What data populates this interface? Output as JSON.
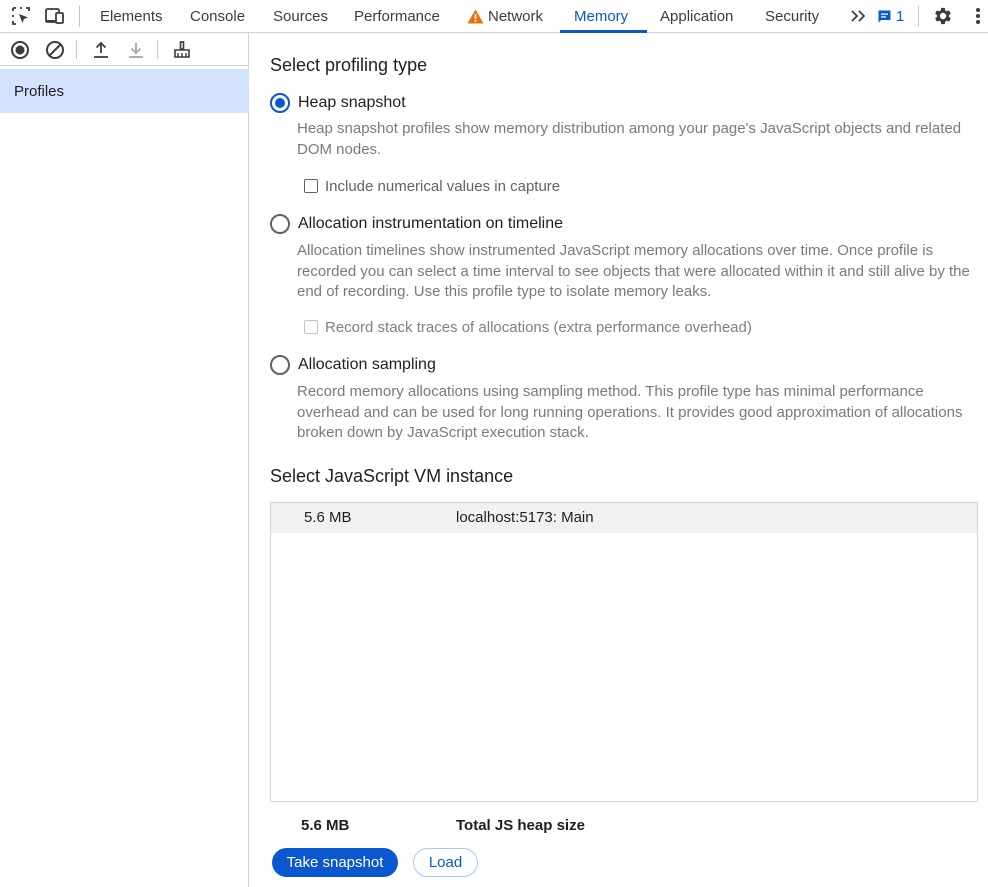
{
  "toolbar": {
    "icons": {
      "inspect": "inspect-element-icon",
      "device": "device-toolbar-icon",
      "more_tabs": "chevron-double-right-icon",
      "issues": "message-icon",
      "settings": "gear-icon",
      "menu": "kebab-menu-icon"
    },
    "tabs": [
      {
        "label": "Elements"
      },
      {
        "label": "Console"
      },
      {
        "label": "Sources"
      },
      {
        "label": "Performance"
      },
      {
        "label": "Network",
        "warning": true
      },
      {
        "label": "Memory",
        "active": true
      },
      {
        "label": "Application"
      },
      {
        "label": "Security"
      }
    ],
    "issues_count": "1"
  },
  "colors": {
    "accent": "#0b57d0",
    "warning": "#e8710a",
    "selected_bg": "#d3e3fd"
  },
  "sidebar": {
    "toolbar_icons": [
      "record-icon",
      "clear-icon",
      "upload-icon",
      "download-icon",
      "garbage-collect-icon"
    ],
    "items": [
      {
        "label": "Profiles",
        "selected": true
      }
    ]
  },
  "main": {
    "profiling_title": "Select profiling type",
    "options": [
      {
        "label": "Heap snapshot",
        "checked": true,
        "description": "Heap snapshot profiles show memory distribution among your page's JavaScript objects and related DOM nodes.",
        "checkbox": {
          "label": "Include numerical values in capture",
          "checked": false,
          "disabled": false
        }
      },
      {
        "label": "Allocation instrumentation on timeline",
        "checked": false,
        "description": "Allocation timelines show instrumented JavaScript memory allocations over time. Once profile is recorded you can select a time interval to see objects that were allocated within it and still alive by the end of recording. Use this profile type to isolate memory leaks.",
        "checkbox": {
          "label": "Record stack traces of allocations (extra performance overhead)",
          "checked": false,
          "disabled": true
        }
      },
      {
        "label": "Allocation sampling",
        "checked": false,
        "description": "Record memory allocations using sampling method. This profile type has minimal performance overhead and can be used for long running operations. It provides good approximation of allocations broken down by JavaScript execution stack."
      }
    ],
    "vm_title": "Select JavaScript VM instance",
    "vm_instances": [
      {
        "size": "5.6 MB",
        "name": "localhost:5173: Main"
      }
    ],
    "total": {
      "size": "5.6 MB",
      "label": "Total JS heap size"
    },
    "buttons": {
      "take_snapshot": "Take snapshot",
      "load": "Load"
    }
  }
}
